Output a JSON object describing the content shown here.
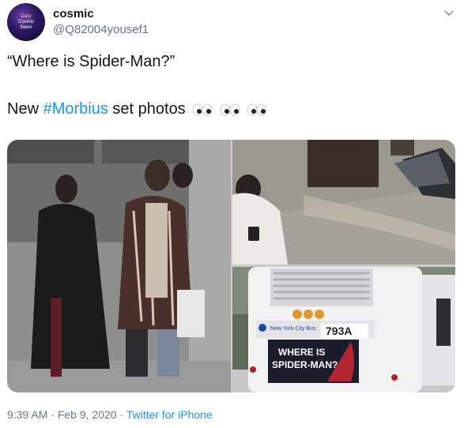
{
  "author": {
    "display_name": "cosmic",
    "handle": "@Q82004yousef1",
    "avatar_text": [
      "Daily",
      "Cosmic",
      "News"
    ]
  },
  "tweet": {
    "quote": "“Where is Spider-Man?”",
    "line2_prefix": "New ",
    "hashtag": "#Morbius",
    "line2_suffix": " set photos"
  },
  "icons": {
    "caret": "chevron-down-icon",
    "emoji": "eyes-emoji-icon"
  },
  "media": {
    "bus_number": "793A",
    "bus_company": "New York City Bus",
    "ad_line1": "WHERE IS",
    "ad_line2": "SPIDER-MAN?"
  },
  "footer": {
    "time": "9:39 AM",
    "date": "Feb 9, 2020",
    "source": "Twitter for iPhone",
    "separator": " · "
  },
  "colors": {
    "link": "#1b95e0",
    "secondary_text": "#657786",
    "primary_text": "#14171a"
  }
}
